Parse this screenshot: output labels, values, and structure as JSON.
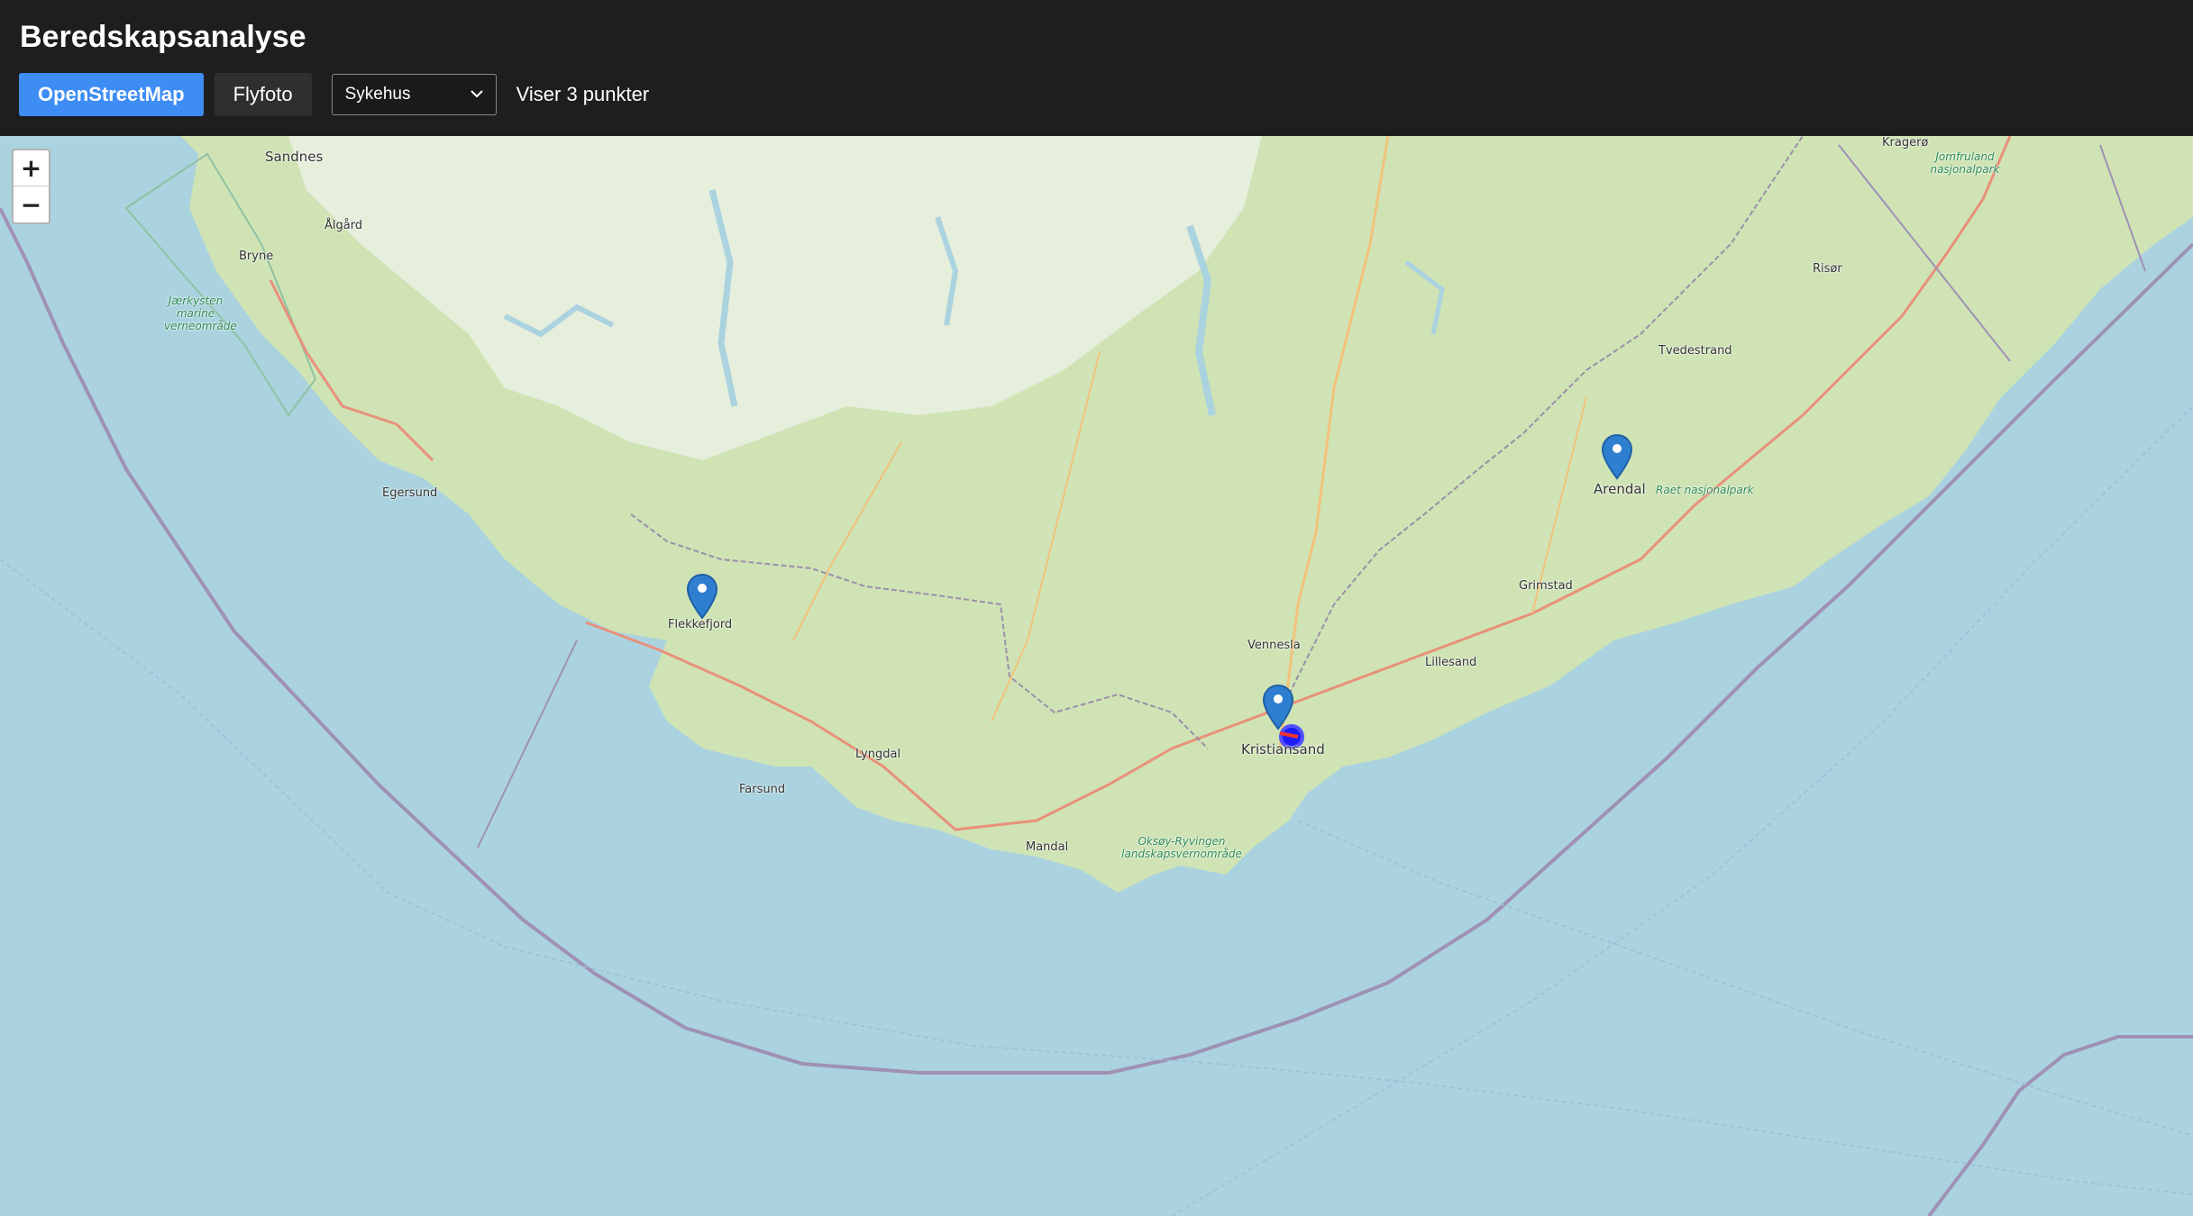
{
  "header": {
    "title": "Beredskapsanalyse",
    "layer_buttons": [
      "OpenStreetMap",
      "Flyfoto"
    ],
    "category_select": {
      "selected": "Sykehus"
    },
    "status_text": "Viser 3 punkter"
  },
  "map": {
    "zoom_in": "+",
    "zoom_out": "−",
    "colors": {
      "sea": "#aad3df",
      "land": "#cfe3b5",
      "highlight": "#1c1cff"
    },
    "place_labels": {
      "sandnes": "Sandnes",
      "algard": "Ålgård",
      "bryne": "Bryne",
      "egersund": "Egersund",
      "flekkefjord": "Flekkefjord",
      "farsund": "Farsund",
      "lyngdal": "Lyngdal",
      "mandal": "Mandal",
      "vennesla": "Vennesla",
      "kristiansand": "Kristiansand",
      "lillesand": "Lillesand",
      "grimstad": "Grimstad",
      "arendal": "Arendal",
      "tvedestrand": "Tvedestrand",
      "risor": "Risør",
      "kragero": "Kragerø"
    },
    "park_labels": {
      "jaerkysten": "Jærkysten marine verneområde",
      "raet": "Raet nasjonalpark",
      "oksoy": "Oksøy-Ryvingen landskapsvernområde",
      "jomfruland": "Jomfruland nasjonalpark"
    },
    "markers": [
      {
        "name": "Flekkefjord",
        "icon": "map-pin-icon"
      },
      {
        "name": "Kristiansand",
        "icon": "map-pin-icon"
      },
      {
        "name": "Arendal",
        "icon": "map-pin-icon"
      }
    ]
  }
}
